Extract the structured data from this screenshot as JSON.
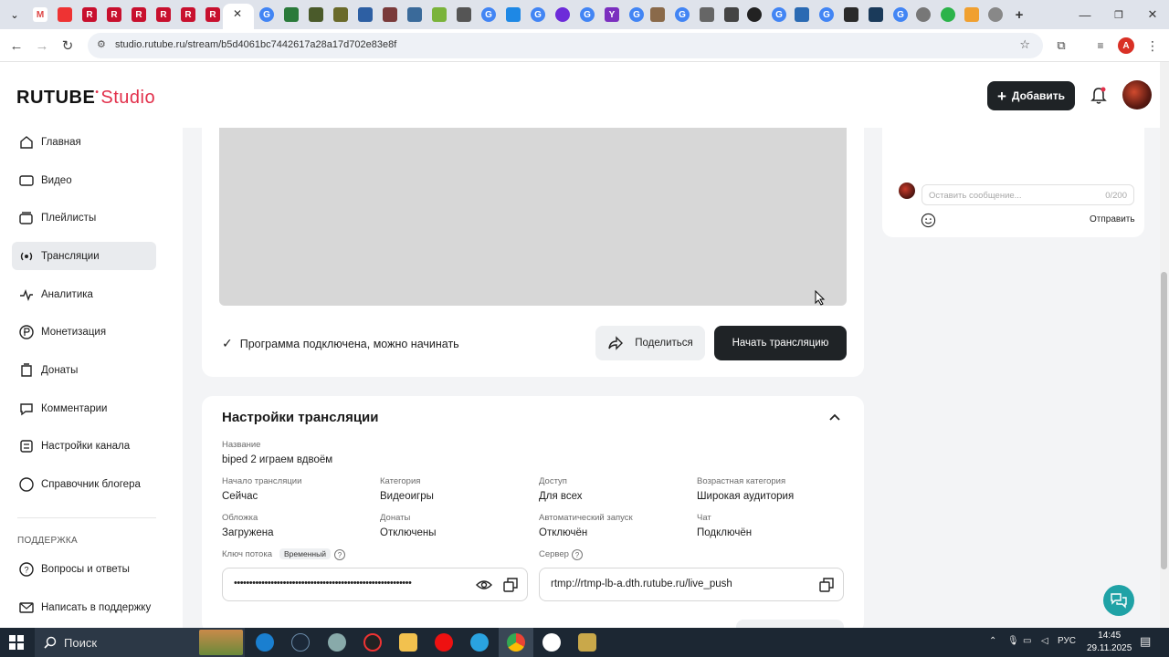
{
  "browser": {
    "url": "studio.rutube.ru/stream/b5d4061bc7442617a28a17d702e83e8f"
  },
  "header": {
    "logo_text": "RUTUBE",
    "logo_studio": "Studio",
    "add_label": "Добавить"
  },
  "sidebar": {
    "items": [
      {
        "label": "Главная",
        "icon": "home-icon"
      },
      {
        "label": "Видео",
        "icon": "video-icon"
      },
      {
        "label": "Плейлисты",
        "icon": "playlist-icon"
      },
      {
        "label": "Трансляции",
        "icon": "broadcast-icon",
        "active": true
      },
      {
        "label": "Аналитика",
        "icon": "analytics-icon"
      },
      {
        "label": "Монетизация",
        "icon": "ruble-icon"
      },
      {
        "label": "Донаты",
        "icon": "donate-icon"
      },
      {
        "label": "Комментарии",
        "icon": "comment-icon"
      },
      {
        "label": "Настройки канала",
        "icon": "settings-icon"
      },
      {
        "label": "Справочник блогера",
        "icon": "help-circle-icon"
      }
    ],
    "support_title": "ПОДДЕРЖКА",
    "support_items": [
      {
        "label": "Вопросы и ответы",
        "icon": "faq-icon"
      },
      {
        "label": "Написать в поддержку",
        "icon": "mail-icon"
      }
    ]
  },
  "stream": {
    "status_text": "Программа подключена, можно начинать",
    "share_label": "Поделиться",
    "start_label": "Начать трансляцию"
  },
  "settings": {
    "title": "Настройки трансляции",
    "name_label": "Название",
    "name_value": "biped 2 играем вдвоём",
    "fields": [
      {
        "label": "Начало трансляции",
        "value": "Сейчас"
      },
      {
        "label": "Категория",
        "value": "Видеоигры"
      },
      {
        "label": "Доступ",
        "value": "Для всех"
      },
      {
        "label": "Возрастная категория",
        "value": "Широкая аудитория"
      },
      {
        "label": "Обложка",
        "value": "Загружена"
      },
      {
        "label": "Донаты",
        "value": "Отключены"
      },
      {
        "label": "Автоматический запуск",
        "value": "Отключён"
      },
      {
        "label": "Чат",
        "value": "Подключён"
      }
    ],
    "key_label": "Ключ потока",
    "key_badge": "Временный",
    "key_masked": "••••••••••••••••••••••••••••••••••••••••••••••••••••••••••",
    "server_label": "Сервер",
    "server_value": "rtmp://rtmp-lb-a.dth.rutube.ru/live_push"
  },
  "chat": {
    "placeholder": "Оставить сообщение...",
    "counter": "0/200",
    "send_label": "Отправить"
  },
  "taskbar": {
    "search_label": "Поиск",
    "lang": "РУС",
    "time": "14:45",
    "date": "29.11.2025"
  },
  "colors": {
    "brand_red": "#e2304b",
    "dark_button": "#1f2326",
    "help_teal": "#1fa2a6"
  }
}
